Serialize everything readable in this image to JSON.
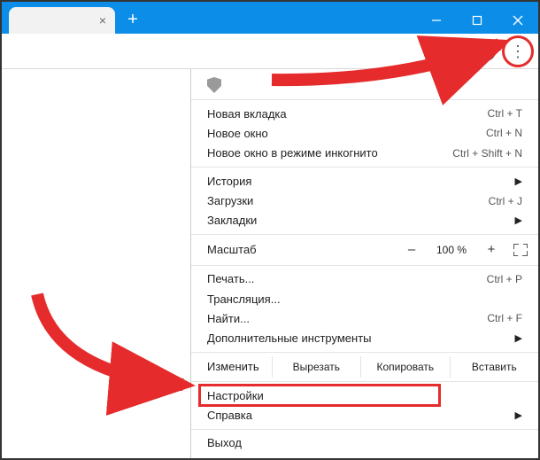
{
  "window": {
    "minimize": "–",
    "close": "×"
  },
  "menu": {
    "new_tab": {
      "label": "Новая вкладка",
      "shortcut": "Ctrl + T"
    },
    "new_window": {
      "label": "Новое окно",
      "shortcut": "Ctrl + N"
    },
    "incognito": {
      "label": "Новое окно в режиме инкогнито",
      "shortcut": "Ctrl + Shift + N"
    },
    "history": {
      "label": "История"
    },
    "downloads": {
      "label": "Загрузки",
      "shortcut": "Ctrl + J"
    },
    "bookmarks": {
      "label": "Закладки"
    },
    "zoom": {
      "label": "Масштаб",
      "minus": "–",
      "value": "100 %",
      "plus": "+"
    },
    "print": {
      "label": "Печать...",
      "shortcut": "Ctrl + P"
    },
    "cast": {
      "label": "Трансляция..."
    },
    "find": {
      "label": "Найти...",
      "shortcut": "Ctrl + F"
    },
    "more_tools": {
      "label": "Дополнительные инструменты"
    },
    "edit": {
      "label": "Изменить",
      "cut": "Вырезать",
      "copy": "Копировать",
      "paste": "Вставить"
    },
    "settings": {
      "label": "Настройки"
    },
    "help": {
      "label": "Справка"
    },
    "exit": {
      "label": "Выход"
    }
  }
}
